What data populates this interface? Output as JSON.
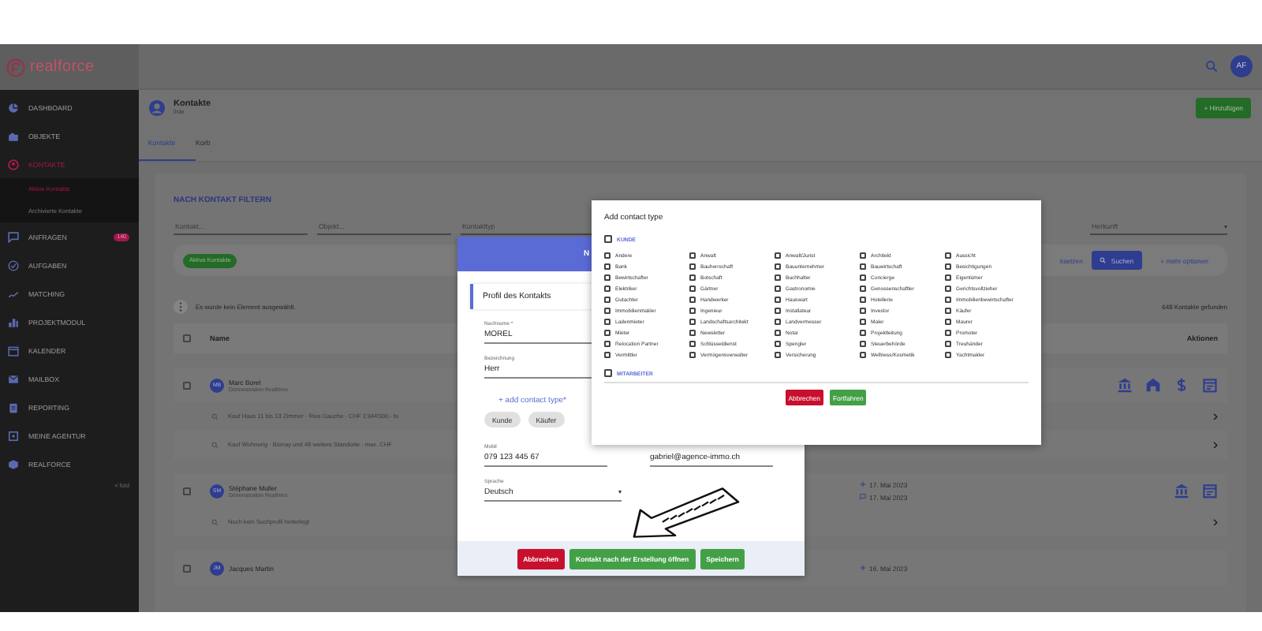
{
  "topbar": {
    "logo": "realforce",
    "avatar": "AF"
  },
  "sidebar": {
    "items": [
      {
        "label": "DASHBOARD",
        "selected": false
      },
      {
        "label": "OBJEKTE",
        "selected": false
      },
      {
        "label": "KONTAKTE",
        "selected": true,
        "children": [
          {
            "label": "Aktive Kontakte",
            "selected": true
          },
          {
            "label": "Archivierte Kontakte",
            "selected": false
          }
        ]
      },
      {
        "label": "ANFRAGEN",
        "selected": false,
        "badge": "140"
      },
      {
        "label": "AUFGABEN",
        "selected": false
      },
      {
        "label": "MATCHING",
        "selected": false
      },
      {
        "label": "PROJEKTMODUL",
        "selected": false
      },
      {
        "label": "KALENDER",
        "selected": false
      },
      {
        "label": "MAILBOX",
        "selected": false
      },
      {
        "label": "REPORTING",
        "selected": false
      },
      {
        "label": "MEINE AGENTUR",
        "selected": false
      },
      {
        "label": "REALFORCE",
        "selected": false
      }
    ],
    "fold": "< fold"
  },
  "page_header": {
    "title": "Kontakte",
    "subtitle": "liste",
    "add_button": "+ Hinzufügen"
  },
  "tabs": [
    {
      "label": "Kontakte",
      "selected": true
    },
    {
      "label": "Korb",
      "selected": false
    }
  ],
  "filter": {
    "heading": "NACH KONTAKT FILTERN",
    "fields": [
      {
        "placeholder": "Kontakt..."
      },
      {
        "placeholder": "Objekt..."
      },
      {
        "label": "Kontakttyp"
      },
      {
        "label": "Herkunft"
      }
    ],
    "chips": [
      "Aktive Kontakte"
    ],
    "reset_button": "ksetzen",
    "search_button": "Suchen",
    "more_button": "+ mehr optionen"
  },
  "selection": {
    "text": "Es wurde kein Element ausgewählt.",
    "count": "648 Kontakte gefunden"
  },
  "table": {
    "columns": [
      "Name",
      "Aktionen"
    ],
    "select_all_checked": false,
    "rows": [
      {
        "checked": false,
        "initials": "MB",
        "name": "Marc Borel",
        "company": "Démonstration Realforce",
        "actions": [
          {
            "kind": "bank"
          },
          {
            "kind": "house"
          },
          {
            "kind": "dollar"
          },
          {
            "kind": "calendar"
          }
        ],
        "profiles": [
          "Kauf Haus 11 bis 13 Zimmer · Rive Gauche · CHF 1'344'000.- bi",
          "Kauf Wohnung · Bionay und 48 weitere Standorte · max. CHF"
        ]
      },
      {
        "checked": false,
        "initials": "SM",
        "name": "Stéphane Muller",
        "company": "Démonstration Realforce",
        "dates": [
          {
            "kind": "created",
            "text": "17. Mai 2023"
          },
          {
            "kind": "message",
            "text": "17. Mai 2023"
          }
        ],
        "actions": [
          {
            "kind": "bank"
          },
          {
            "kind": "calendar"
          }
        ],
        "profiles": [
          "Noch kein Suchprofil hinterlegt"
        ]
      },
      {
        "checked": false,
        "initials": "JM",
        "name": "Jacques Martin",
        "dates": [
          {
            "kind": "created",
            "text": "16. Mai 2023"
          }
        ]
      }
    ]
  },
  "contact_form": {
    "header_text": "N",
    "section": "Profil des Kontakts",
    "fields": [
      {
        "label": "Nachname *",
        "value": "MOREL"
      },
      {
        "label": "Bezeichnung",
        "value": "Herr"
      }
    ],
    "add_type": "+ add contact type*",
    "chips": [
      "Kunde",
      "Käufer"
    ],
    "phone": {
      "label": "Mobil",
      "value": "079 123 445 67"
    },
    "email": {
      "value": "gabriel@agence-immo.ch"
    },
    "language": {
      "label": "Sprache",
      "value": "Deutsch"
    },
    "buttons": [
      {
        "label": "Abbrechen",
        "kind": "cancel"
      },
      {
        "label": "Kontakt nach der Erstellung öffnen",
        "kind": "confirm"
      },
      {
        "label": "Speichern",
        "kind": "confirm"
      }
    ]
  },
  "type_dialog": {
    "title": "Add contact type",
    "groups": [
      {
        "label": "KUNDE",
        "checked": false,
        "items": [
          {
            "label": "Andere",
            "checked": false
          },
          {
            "label": "Anwalt",
            "checked": false
          },
          {
            "label": "Anwalt/Jurist",
            "checked": false
          },
          {
            "label": "Architekt",
            "checked": false
          },
          {
            "label": "Aussicht",
            "checked": false
          },
          {
            "label": "Bank",
            "checked": false
          },
          {
            "label": "Bauherrschaft",
            "checked": false
          },
          {
            "label": "Bauunternehmer",
            "checked": false
          },
          {
            "label": "Bauwirtschaft",
            "checked": false
          },
          {
            "label": "Besichtigungen",
            "checked": false
          },
          {
            "label": "Bewirtschafter",
            "checked": false
          },
          {
            "label": "Botschaft",
            "checked": false
          },
          {
            "label": "Buchhalter",
            "checked": false
          },
          {
            "label": "Concierge",
            "checked": false
          },
          {
            "label": "Eigentümer",
            "checked": false
          },
          {
            "label": "Elektriker",
            "checked": false
          },
          {
            "label": "Gärtner",
            "checked": false
          },
          {
            "label": "Gastronomie",
            "checked": false
          },
          {
            "label": "Genossenschaftler",
            "checked": false
          },
          {
            "label": "Gerichtsvollzieher",
            "checked": false
          },
          {
            "label": "Gutachter",
            "checked": false
          },
          {
            "label": "Handwerker",
            "checked": false
          },
          {
            "label": "Hauswart",
            "checked": false
          },
          {
            "label": "Hotellerie",
            "checked": false
          },
          {
            "label": "Immobilienbewirtschafter",
            "checked": false
          },
          {
            "label": "Immobilienmakler",
            "checked": false
          },
          {
            "label": "Ingenieur",
            "checked": false
          },
          {
            "label": "Installateur",
            "checked": false
          },
          {
            "label": "Investor",
            "checked": false
          },
          {
            "label": "Käufer",
            "checked": false
          },
          {
            "label": "Ladenmieter",
            "checked": false
          },
          {
            "label": "Landschaftsarchitekt",
            "checked": false
          },
          {
            "label": "Landvermesser",
            "checked": false
          },
          {
            "label": "Maler",
            "checked": false
          },
          {
            "label": "Maurer",
            "checked": false
          },
          {
            "label": "Mieter",
            "checked": false
          },
          {
            "label": "Newsletter",
            "checked": false
          },
          {
            "label": "Notar",
            "checked": false
          },
          {
            "label": "Projektleitung",
            "checked": false
          },
          {
            "label": "Promoter",
            "checked": false
          },
          {
            "label": "Relocation Partner",
            "checked": false
          },
          {
            "label": "Schlüsseldienst",
            "checked": false
          },
          {
            "label": "Spengler",
            "checked": false
          },
          {
            "label": "Steuerbehörde",
            "checked": false
          },
          {
            "label": "Treuhänder",
            "checked": false
          },
          {
            "label": "Vermittler",
            "checked": false
          },
          {
            "label": "Vermögensverwalter",
            "checked": false
          },
          {
            "label": "Versicherung",
            "checked": false
          },
          {
            "label": "Wellness/Kosmetik",
            "checked": false
          },
          {
            "label": "Yachtmakler",
            "checked": false
          }
        ]
      },
      {
        "label": "MITARBEITER",
        "checked": false
      }
    ],
    "buttons": [
      {
        "label": "Abbrechen",
        "kind": "cancel"
      },
      {
        "label": "Fortfahren",
        "kind": "confirm"
      }
    ]
  }
}
